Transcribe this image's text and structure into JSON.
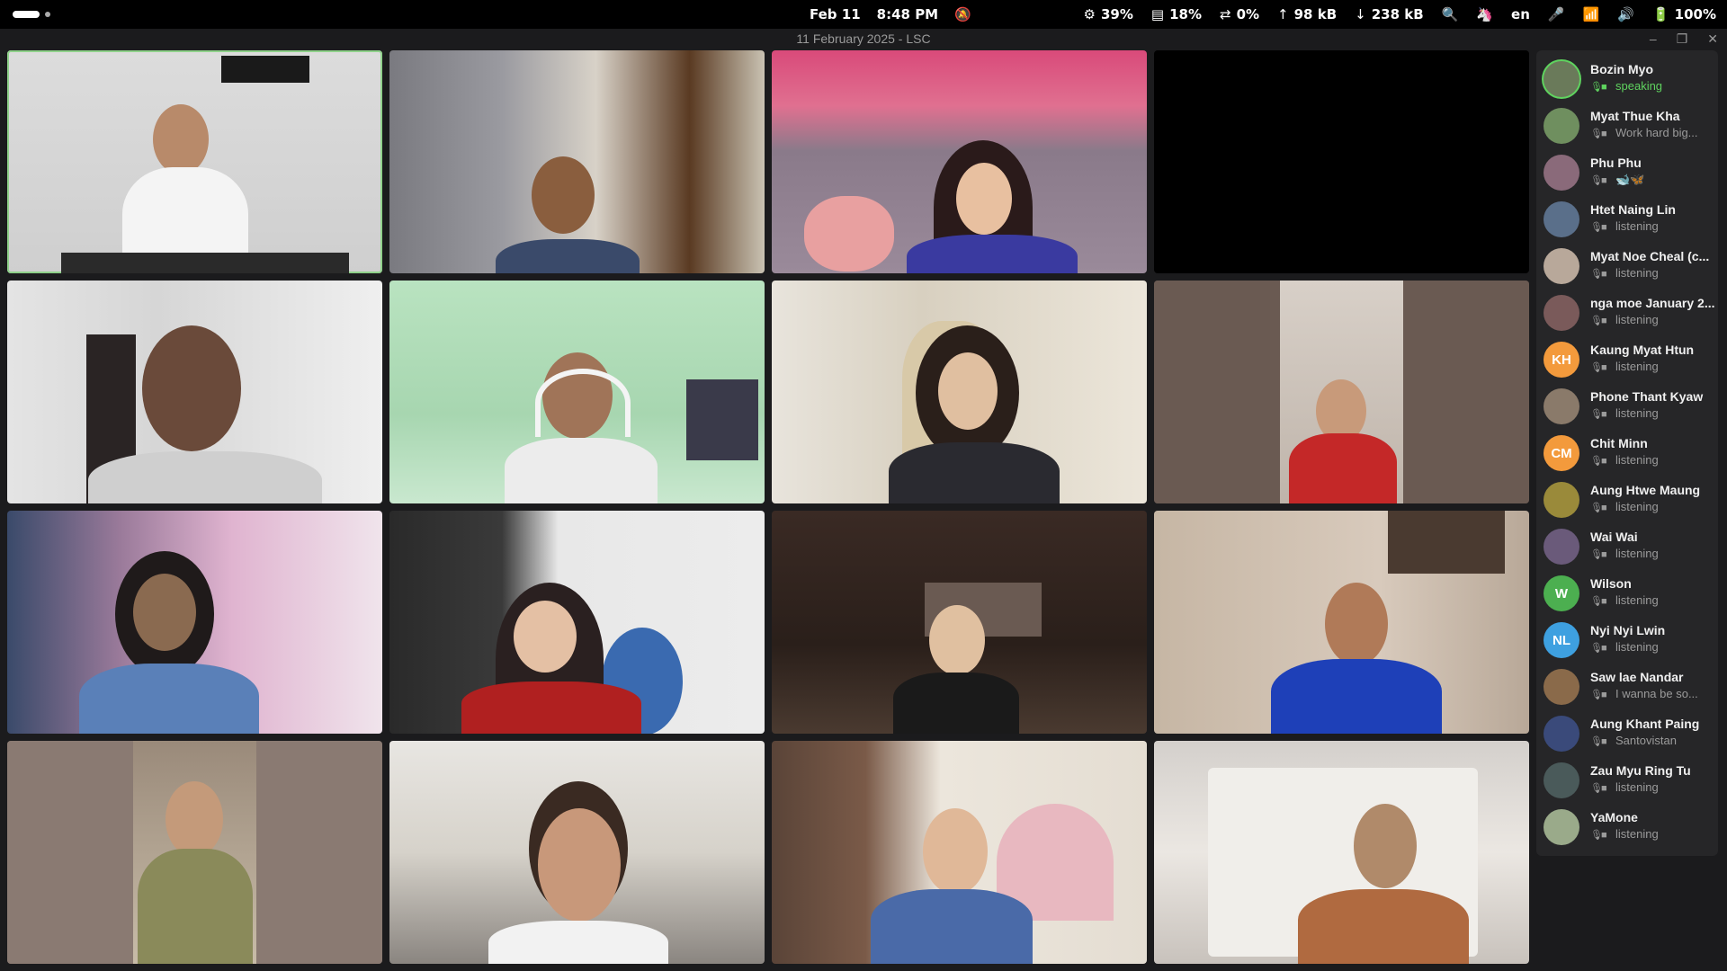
{
  "topbar": {
    "date": "Feb 11",
    "time": "8:48 PM",
    "cpu": "39%",
    "mem": "18%",
    "swap": "0%",
    "up": "98 kB",
    "down": "238 kB",
    "lang": "en",
    "battery": "100%"
  },
  "window": {
    "title": "11 February 2025 - LSC"
  },
  "participants": [
    {
      "name": "Bozin Myo",
      "status": "speaking",
      "initials": "",
      "color": "#6a7a5a"
    },
    {
      "name": "Myat Thue Kha",
      "status": "Work hard big...",
      "initials": "",
      "color": "#6f8f5f"
    },
    {
      "name": "Phu Phu",
      "status": "🐋🦋",
      "initials": "",
      "color": "#8a6a7a"
    },
    {
      "name": "Htet Naing Lin",
      "status": "listening",
      "initials": "",
      "color": "#5a6f8a"
    },
    {
      "name": "Myat Noe Cheal (c...",
      "status": "listening",
      "initials": "",
      "color": "#b8a89a"
    },
    {
      "name": "nga moe January 2...",
      "status": "listening",
      "initials": "",
      "color": "#7a5a5a"
    },
    {
      "name": "Kaung Myat Htun",
      "status": "listening",
      "initials": "KH",
      "color": "#f39a3c"
    },
    {
      "name": "Phone Thant Kyaw",
      "status": "listening",
      "initials": "",
      "color": "#8a7a6a"
    },
    {
      "name": "Chit Minn",
      "status": "listening",
      "initials": "CM",
      "color": "#f39a3c"
    },
    {
      "name": "Aung Htwe Maung",
      "status": "listening",
      "initials": "",
      "color": "#9a8a3a"
    },
    {
      "name": "Wai Wai",
      "status": "listening",
      "initials": "",
      "color": "#6a5a7a"
    },
    {
      "name": "Wilson",
      "status": "listening",
      "initials": "W",
      "color": "#4caf50"
    },
    {
      "name": "Nyi Nyi Lwin",
      "status": "listening",
      "initials": "NL",
      "color": "#3ea0e0"
    },
    {
      "name": "Saw lae Nandar",
      "status": "I wanna be so...",
      "initials": "",
      "color": "#8a6a4a"
    },
    {
      "name": "Aung Khant Paing",
      "status": "Santovistan",
      "initials": "",
      "color": "#3a4a7a"
    },
    {
      "name": "Zau Myu Ring Tu",
      "status": "listening",
      "initials": "",
      "color": "#4a5a5a"
    },
    {
      "name": "YaMone",
      "status": "listening",
      "initials": "",
      "color": "#9aaa8a"
    }
  ],
  "icons": {
    "mic_on": "🎙",
    "mic_off": "🎙",
    "cam": "▪"
  }
}
